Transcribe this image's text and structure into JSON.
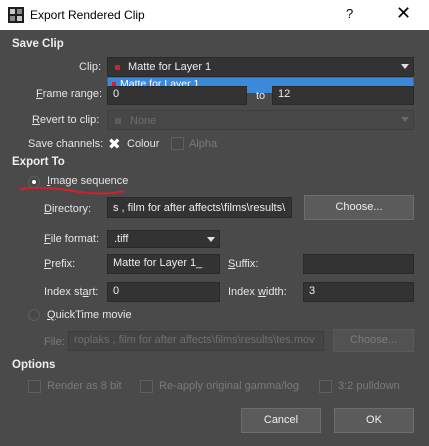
{
  "window": {
    "title": "Export Rendered Clip",
    "help_glyph": "?",
    "close_glyph": "✕",
    "accent": "#d3202a"
  },
  "save_clip": {
    "heading": "Save Clip",
    "clip_label": "Clip:",
    "clip_value": "Matte for Layer 1",
    "clip_dropdown_item": "Matte for Layer 1",
    "frame_range_label": "Frame range:",
    "frame_from": "0",
    "frame_to_label": "to",
    "frame_to": "12",
    "revert_label": "Revert to clip:",
    "revert_value": "None",
    "save_channels_label": "Save channels:",
    "colour_label": "Colour",
    "alpha_label": "Alpha"
  },
  "export_to": {
    "heading": "Export To",
    "image_sequence_label": "Image sequence",
    "directory_label": "Directory:",
    "directory_value": "s , film for after affects\\films\\results\\",
    "choose_label": "Choose...",
    "file_format_label": "File format:",
    "file_format_value": ".tiff",
    "prefix_label": "Prefix:",
    "prefix_value": "Matte for Layer 1_",
    "suffix_label": "Suffix:",
    "suffix_value": "",
    "index_start_label": "Index start:",
    "index_start_value": "0",
    "index_width_label": "Index width:",
    "index_width_value": "3",
    "quicktime_label": "QuickTime movie",
    "file_label": "File:",
    "file_value": "roplaks , film for after affects\\films\\results\\tes.mov",
    "choose2_label": "Choose..."
  },
  "options": {
    "heading": "Options",
    "render8bit_label": "Render as 8 bit",
    "reapply_label": "Re-apply original gamma/log",
    "pulldown_label": "3:2 pulldown"
  },
  "footer": {
    "cancel_label": "Cancel",
    "ok_label": "OK"
  }
}
